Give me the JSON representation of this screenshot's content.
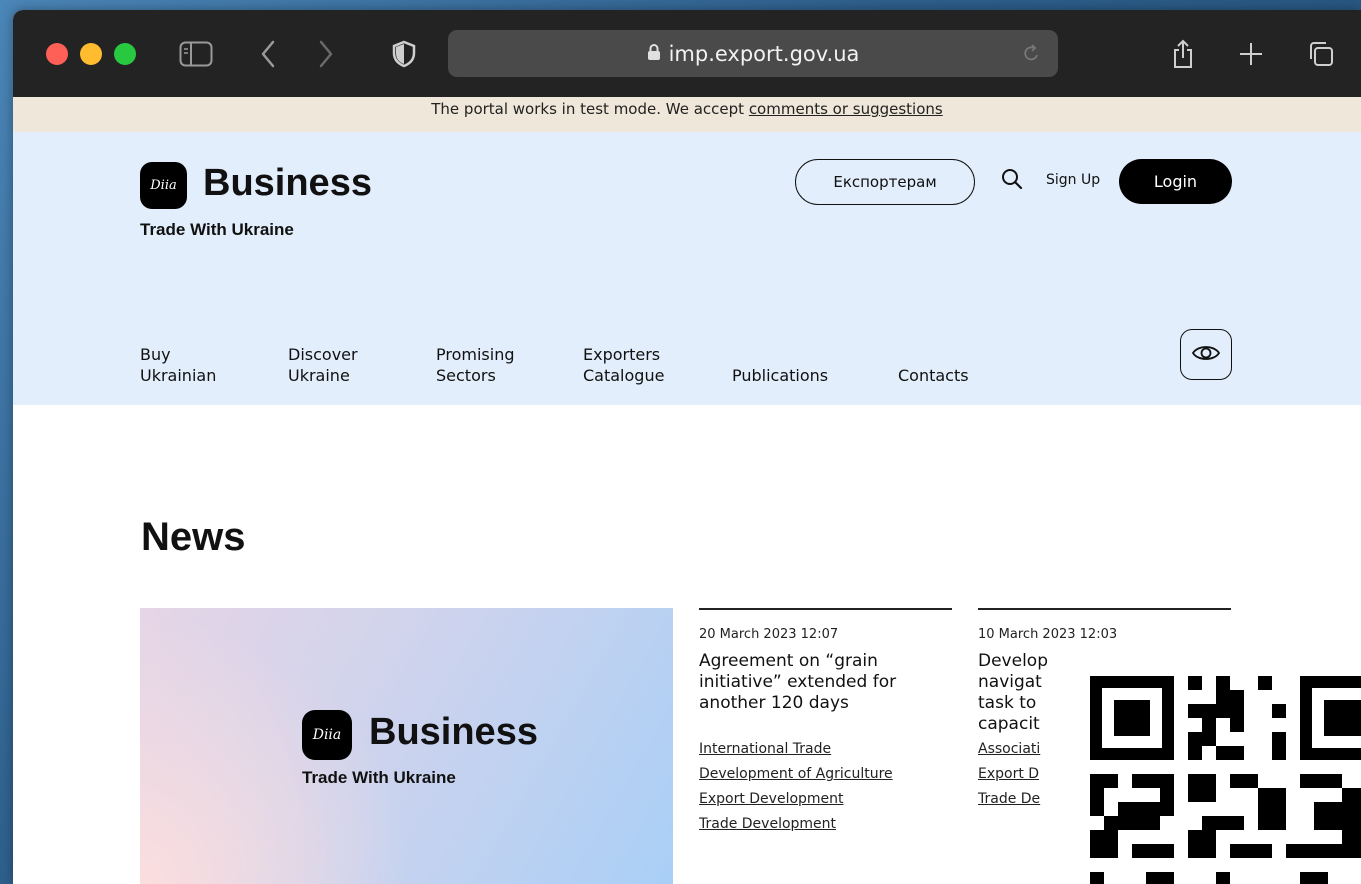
{
  "browser": {
    "url": "imp.export.gov.ua"
  },
  "notice": {
    "text": "The portal works in test mode. We accept ",
    "link": "comments or suggestions"
  },
  "header": {
    "logo_badge": "Diia",
    "logo_text": "Business",
    "tagline": "Trade With Ukraine",
    "exporters_button": "Експортерам",
    "signup": "Sign Up",
    "login": "Login"
  },
  "nav": {
    "items": [
      {
        "line1": "Buy",
        "line2": "Ukrainian"
      },
      {
        "line1": "Discover",
        "line2": "Ukraine"
      },
      {
        "line1": "Promising",
        "line2": "Sectors"
      },
      {
        "line1": "Exporters",
        "line2": "Catalogue"
      },
      {
        "line1": "",
        "line2": "Publications"
      },
      {
        "line1": "",
        "line2": "Contacts"
      }
    ]
  },
  "main": {
    "section_title": "News",
    "feature": {
      "badge": "Diia",
      "title": "Business",
      "tagline": "Trade With Ukraine"
    },
    "news": [
      {
        "date": "20 March 2023 12:07",
        "headline": "Agreement on “grain initiative” extended for another 120 days",
        "tags": [
          "International Trade",
          "Development of Agriculture",
          "Export Development",
          "Trade Development"
        ]
      },
      {
        "date": "10 March 2023 12:03",
        "headline": "Develop navigat task to capacit",
        "tags": [
          "Associati",
          "Export D",
          "Trade De"
        ]
      }
    ]
  },
  "icons": {
    "sidebar": "sidebar-icon",
    "back": "chevron-left-icon",
    "forward": "chevron-right-icon",
    "shield": "shield-icon",
    "lock": "lock-icon",
    "reload": "reload-icon",
    "share": "share-icon",
    "new_tab": "plus-icon",
    "tabs": "tabs-icon",
    "search": "search-icon",
    "accessibility": "eye-icon"
  },
  "colors": {
    "toolbar": "#232323",
    "notice_bg": "#efe7d9",
    "header_bg": "#e2eefb",
    "brand": "#000000"
  }
}
